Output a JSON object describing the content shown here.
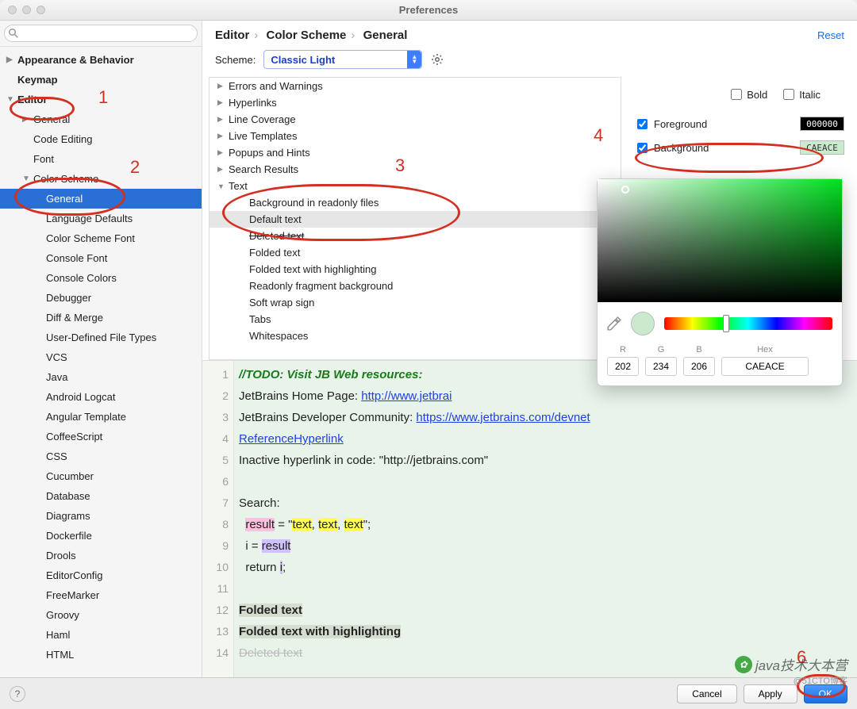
{
  "window": {
    "title": "Preferences"
  },
  "search": {
    "placeholder": ""
  },
  "sidebar": {
    "items": [
      {
        "label": "Appearance & Behavior",
        "lvl": 1,
        "arrow": "▶",
        "bold": true
      },
      {
        "label": "Keymap",
        "lvl": 1,
        "arrow": "",
        "bold": true
      },
      {
        "label": "Editor",
        "lvl": 1,
        "arrow": "▼",
        "bold": true
      },
      {
        "label": "General",
        "lvl": 2,
        "arrow": "▶",
        "bold": false
      },
      {
        "label": "Code Editing",
        "lvl": 2,
        "arrow": "",
        "bold": false
      },
      {
        "label": "Font",
        "lvl": 2,
        "arrow": "",
        "bold": false
      },
      {
        "label": "Color Scheme",
        "lvl": 2,
        "arrow": "▼",
        "bold": false
      },
      {
        "label": "General",
        "lvl": 3,
        "arrow": "",
        "bold": false,
        "sel": true
      },
      {
        "label": "Language Defaults",
        "lvl": 3,
        "arrow": "",
        "bold": false
      },
      {
        "label": "Color Scheme Font",
        "lvl": 3,
        "arrow": "",
        "bold": false
      },
      {
        "label": "Console Font",
        "lvl": 3,
        "arrow": "",
        "bold": false
      },
      {
        "label": "Console Colors",
        "lvl": 3,
        "arrow": "",
        "bold": false
      },
      {
        "label": "Debugger",
        "lvl": 3,
        "arrow": "",
        "bold": false
      },
      {
        "label": "Diff & Merge",
        "lvl": 3,
        "arrow": "",
        "bold": false
      },
      {
        "label": "User-Defined File Types",
        "lvl": 3,
        "arrow": "",
        "bold": false
      },
      {
        "label": "VCS",
        "lvl": 3,
        "arrow": "",
        "bold": false
      },
      {
        "label": "Java",
        "lvl": 3,
        "arrow": "",
        "bold": false
      },
      {
        "label": "Android Logcat",
        "lvl": 3,
        "arrow": "",
        "bold": false
      },
      {
        "label": "Angular Template",
        "lvl": 3,
        "arrow": "",
        "bold": false
      },
      {
        "label": "CoffeeScript",
        "lvl": 3,
        "arrow": "",
        "bold": false
      },
      {
        "label": "CSS",
        "lvl": 3,
        "arrow": "",
        "bold": false
      },
      {
        "label": "Cucumber",
        "lvl": 3,
        "arrow": "",
        "bold": false
      },
      {
        "label": "Database",
        "lvl": 3,
        "arrow": "",
        "bold": false
      },
      {
        "label": "Diagrams",
        "lvl": 3,
        "arrow": "",
        "bold": false
      },
      {
        "label": "Dockerfile",
        "lvl": 3,
        "arrow": "",
        "bold": false
      },
      {
        "label": "Drools",
        "lvl": 3,
        "arrow": "",
        "bold": false
      },
      {
        "label": "EditorConfig",
        "lvl": 3,
        "arrow": "",
        "bold": false
      },
      {
        "label": "FreeMarker",
        "lvl": 3,
        "arrow": "",
        "bold": false
      },
      {
        "label": "Groovy",
        "lvl": 3,
        "arrow": "",
        "bold": false
      },
      {
        "label": "Haml",
        "lvl": 3,
        "arrow": "",
        "bold": false
      },
      {
        "label": "HTML",
        "lvl": 3,
        "arrow": "",
        "bold": false
      }
    ]
  },
  "breadcrumb": {
    "a": "Editor",
    "b": "Color Scheme",
    "c": "General",
    "reset": "Reset"
  },
  "scheme": {
    "label": "Scheme:",
    "value": "Classic Light"
  },
  "attrs": [
    {
      "label": "Errors and Warnings",
      "lvl": 1,
      "arrow": "▶"
    },
    {
      "label": "Hyperlinks",
      "lvl": 1,
      "arrow": "▶"
    },
    {
      "label": "Line Coverage",
      "lvl": 1,
      "arrow": "▶"
    },
    {
      "label": "Live Templates",
      "lvl": 1,
      "arrow": "▶"
    },
    {
      "label": "Popups and Hints",
      "lvl": 1,
      "arrow": "▶"
    },
    {
      "label": "Search Results",
      "lvl": 1,
      "arrow": "▶"
    },
    {
      "label": "Text",
      "lvl": 1,
      "arrow": "▼"
    },
    {
      "label": "Background in readonly files",
      "lvl": 2,
      "arrow": ""
    },
    {
      "label": "Default text",
      "lvl": 2,
      "arrow": "",
      "sel": true
    },
    {
      "label": "Deleted text",
      "lvl": 2,
      "arrow": "",
      "strike": true
    },
    {
      "label": "Folded text",
      "lvl": 2,
      "arrow": ""
    },
    {
      "label": "Folded text with highlighting",
      "lvl": 2,
      "arrow": ""
    },
    {
      "label": "Readonly fragment background",
      "lvl": 2,
      "arrow": ""
    },
    {
      "label": "Soft wrap sign",
      "lvl": 2,
      "arrow": ""
    },
    {
      "label": "Tabs",
      "lvl": 2,
      "arrow": ""
    },
    {
      "label": "Whitespaces",
      "lvl": 2,
      "arrow": ""
    }
  ],
  "fontOpts": {
    "bold": "Bold",
    "italic": "Italic"
  },
  "props": {
    "foreground": {
      "label": "Foreground",
      "value": "000000",
      "checked": true,
      "bg": "#000",
      "fg": "#fff"
    },
    "background": {
      "label": "Background",
      "value": "CAEACE",
      "checked": true,
      "bg": "#CAEACE",
      "fg": "#333"
    }
  },
  "picker": {
    "r_label": "R",
    "g_label": "G",
    "b_label": "B",
    "hex_label": "Hex",
    "r": "202",
    "g": "234",
    "b": "206",
    "hex": "CAEACE"
  },
  "preview": {
    "gutter": [
      "1",
      "2",
      "3",
      "4",
      "5",
      "6",
      "7",
      "8",
      "9",
      "10",
      "11",
      "12",
      "13",
      "14"
    ],
    "l1": "//TODO: Visit JB Web resources:",
    "l2a": "JetBrains Home Page: ",
    "l2b": "http://www.jetbrai",
    "l3a": "JetBrains Developer Community: ",
    "l3b": "https://www.jetbrains.com/devnet",
    "l4": "ReferenceHyperlink",
    "l5": "Inactive hyperlink in code: \"http://jetbrains.com\"",
    "l7": "Search:",
    "l8a": "result",
    "l8b": " = \"",
    "l8c": "text",
    "l8d": ", ",
    "l8e": "text",
    "l8f": ", ",
    "l8g": "text",
    "l8h": "\";",
    "l9a": "i = ",
    "l9b": "result",
    "l10a": "return ",
    "l10b": "i",
    "l10c": ";",
    "l12": "Folded text",
    "l13": "Folded text with highlighting",
    "l14": "Deleted text"
  },
  "footer": {
    "cancel": "Cancel",
    "apply": "Apply",
    "ok": "OK"
  },
  "annotations": {
    "1": "1",
    "2": "2",
    "3": "3",
    "4": "4",
    "6": "6"
  },
  "watermark": {
    "text": "java技术大本营",
    "sub": "@51CTO博客"
  }
}
